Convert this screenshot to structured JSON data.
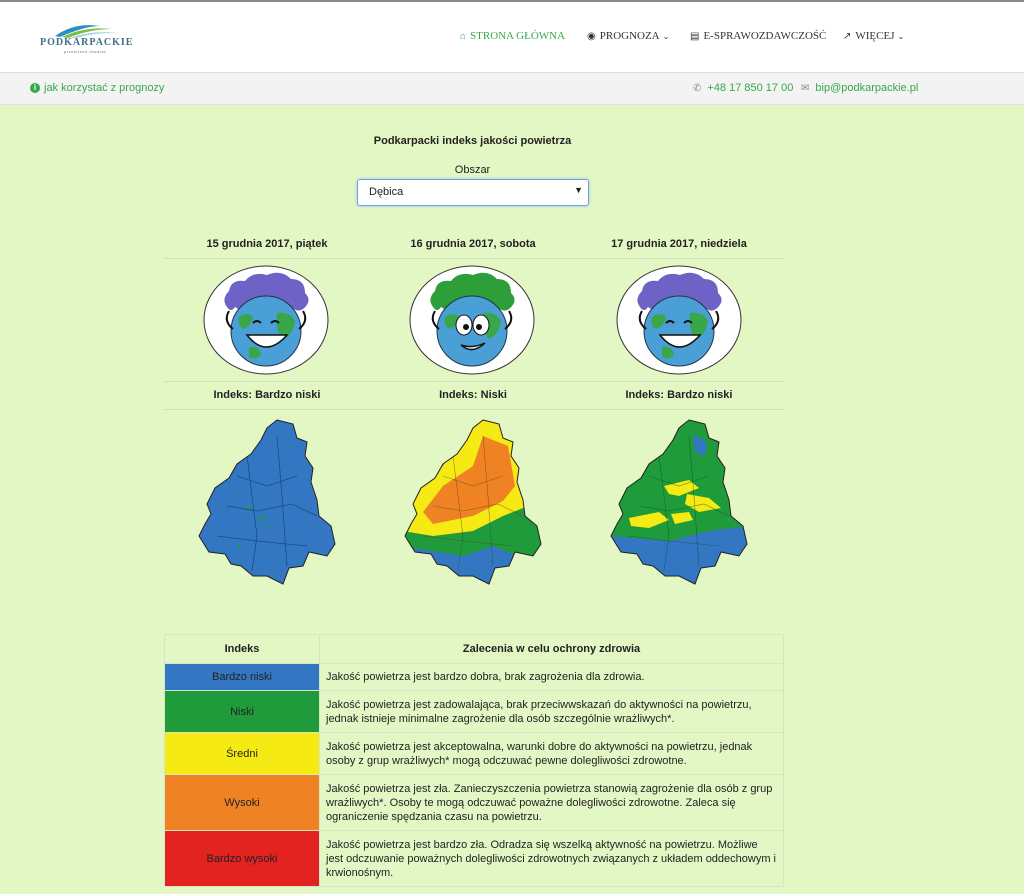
{
  "brand": {
    "name": "PODKARPACKIE",
    "tagline": "przestrzeń otwarta"
  },
  "nav": {
    "home": "STRONA GŁÓWNA",
    "forecast": "PROGNOZA",
    "reporting": "E-SPRAWOZDAWCZOŚĆ",
    "more": "WIĘCEJ"
  },
  "subbar": {
    "help": "jak korzystać z prognozy",
    "phone": "+48 17 850 17 00",
    "email": "bip@podkarpackie.pl"
  },
  "page": {
    "title": "Podkarpacki indeks jakości powietrza",
    "area_label": "Obszar",
    "area_value": "Dębica"
  },
  "days": [
    {
      "date": "15 grudnia 2017, piątek",
      "index": "Indeks: Bardzo niski",
      "face": "cloud-purple-smile"
    },
    {
      "date": "16 grudnia 2017, sobota",
      "index": "Indeks: Niski",
      "face": "cloud-green-worried"
    },
    {
      "date": "17 grudnia 2017, niedziela",
      "index": "Indeks: Bardzo niski",
      "face": "cloud-purple-smile"
    }
  ],
  "legend": {
    "col_index": "Indeks",
    "col_recommend": "Zalecenia w celu ochrony zdrowia",
    "rows": [
      {
        "level": "Bardzo niski",
        "color": "#3377c2",
        "text": "Jakość powietrza jest bardzo dobra, brak zagrożenia dla zdrowia."
      },
      {
        "level": "Niski",
        "color": "#1f9b3c",
        "text": "Jakość powietrza jest zadowalająca, brak przeciwwskazań do aktywności na powietrzu, jednak istnieje minimalne zagrożenie dla osób szczególnie wrażliwych*."
      },
      {
        "level": "Średni",
        "color": "#f5ea14",
        "text": "Jakość powietrza jest akceptowalna, warunki dobre do aktywności na powietrzu, jednak osoby z grup wrażliwych* mogą odczuwać pewne dolegliwości zdrowotne."
      },
      {
        "level": "Wysoki",
        "color": "#ef8324",
        "text": "Jakość powietrza jest zła. Zanieczyszczenia powietrza stanowią zagrożenie dla osób z grup wrażliwych*. Osoby te mogą odczuwać poważne dolegliwości zdrowotne. Zaleca się ograniczenie spędzania czasu na powietrzu."
      },
      {
        "level": "Bardzo wysoki",
        "color": "#e32320",
        "text": "Jakość powietrza jest bardzo zła. Odradza się wszelką aktywność na powietrzu. Możliwe jest odczuwanie poważnych dolegliwości zdrowotnych związanych z układem oddechowym i krwionośnym."
      }
    ]
  }
}
